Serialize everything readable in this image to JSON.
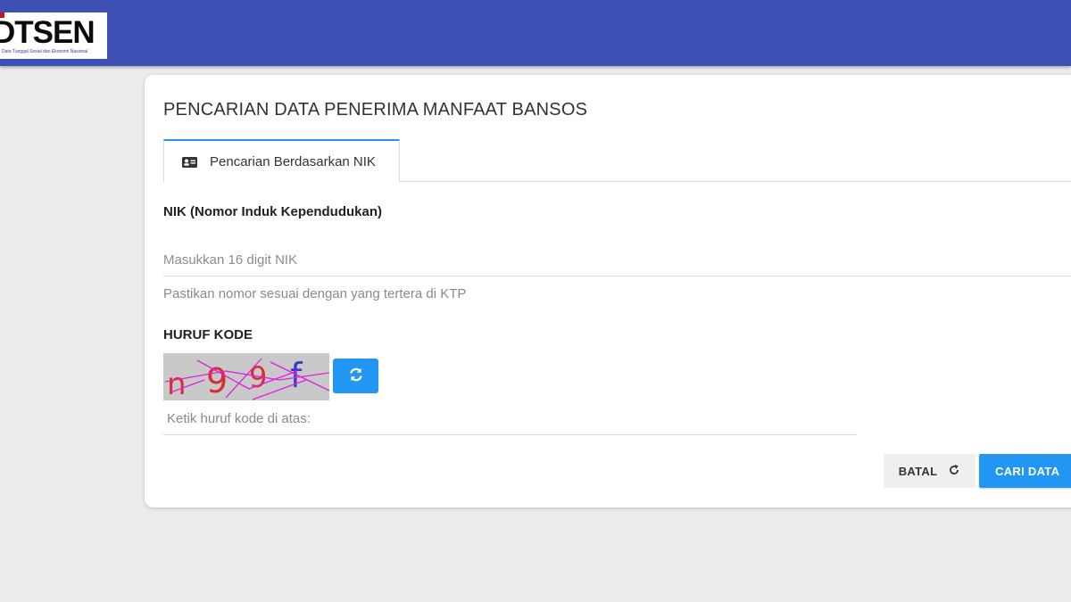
{
  "header": {
    "logo_text": "DTSEN",
    "logo_tagline": "Data Tunggal Sosial dan Ekonomi Nasional"
  },
  "card": {
    "title": "PENCARIAN DATA PENERIMA MANFAAT BANSOS",
    "tabs": [
      {
        "label": "Pencarian Berdasarkan NIK",
        "icon": "id-card-icon",
        "active": true
      }
    ],
    "nik": {
      "label": "NIK (Nomor Induk Kependudukan)",
      "placeholder": "Masukkan 16 digit NIK",
      "value": "",
      "hint": "Pastikan nomor sesuai dengan yang tertera di KTP"
    },
    "captcha": {
      "label": "HURUF KODE",
      "characters": [
        "n",
        "9",
        "9",
        "f"
      ],
      "input_placeholder": "Ketik huruf kode di atas:",
      "refresh_icon": "refresh-icon"
    },
    "buttons": {
      "cancel_label": "BATAL",
      "cancel_icon": "reload-icon",
      "search_label": "CARI DATA",
      "search_icon": "search-icon"
    }
  },
  "colors": {
    "header_bg": "#3d51b5",
    "accent": "#2196f3",
    "page_bg": "#ececec",
    "logo_red": "#d0141b"
  }
}
